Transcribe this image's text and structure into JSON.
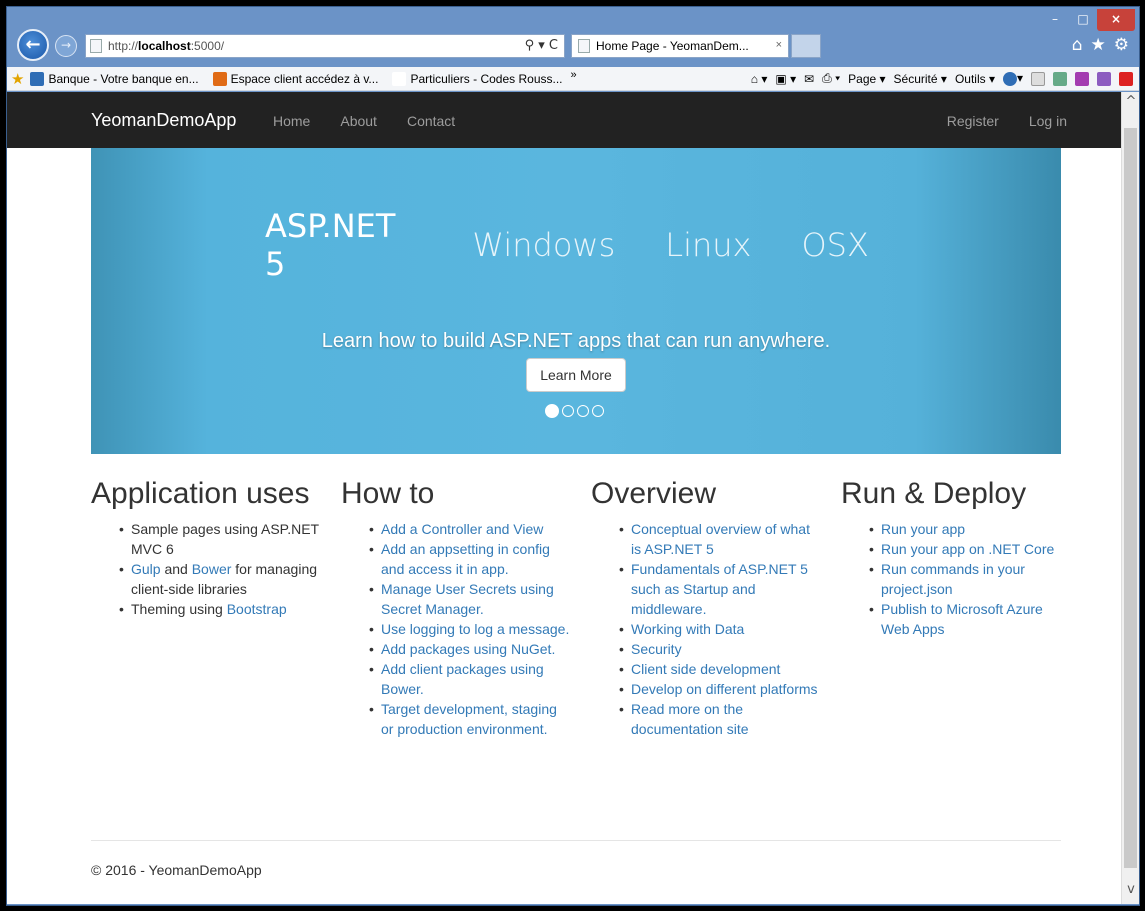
{
  "browser": {
    "window_controls": {
      "minimize": "–",
      "maximize": "□",
      "close": "×"
    },
    "address": {
      "url_prefix": "http://",
      "url_host": "localhost",
      "url_port": ":5000/"
    },
    "address_tools": "⚲ ▾ C",
    "tab": {
      "title": "Home Page - YeomanDem...",
      "close": "×"
    },
    "right_icons": {
      "home": "⌂",
      "favorites": "★",
      "settings": "⚙"
    },
    "favorites": [
      {
        "label": "Banque - Votre banque en...",
        "color": "#2f6db5"
      },
      {
        "label": "Espace client  accédez à v...",
        "color": "#e06b16"
      },
      {
        "label": "Particuliers - Codes Rouss...",
        "color": "#ffffff"
      }
    ],
    "favorites_overflow": "»",
    "commands": {
      "page": "Page ▾",
      "security": "Sécurité ▾",
      "tools": "Outils ▾",
      "help": "▾"
    }
  },
  "site": {
    "brand": "YeomanDemoApp",
    "nav": [
      "Home",
      "About",
      "Contact"
    ],
    "nav_right": [
      "Register",
      "Log in"
    ],
    "hero": {
      "main": "ASP.NET 5",
      "words": [
        "Windows",
        "Linux",
        "OSX"
      ],
      "caption": "Learn how to build ASP.NET apps that can run anywhere.",
      "button": "Learn More"
    },
    "columns": [
      {
        "heading": "Application uses",
        "items": [
          [
            {
              "text": "Sample pages using ASP.NET MVC 6",
              "link": false
            }
          ],
          [
            {
              "text": "Gulp",
              "link": true
            },
            {
              "text": " and ",
              "link": false
            },
            {
              "text": "Bower",
              "link": true
            },
            {
              "text": " for managing client-side libraries",
              "link": false
            }
          ],
          [
            {
              "text": "Theming using ",
              "link": false
            },
            {
              "text": "Bootstrap",
              "link": true
            }
          ]
        ]
      },
      {
        "heading": "How to",
        "items": [
          [
            {
              "text": "Add a Controller and View",
              "link": true
            }
          ],
          [
            {
              "text": "Add an appsetting in config and access it in app.",
              "link": true
            }
          ],
          [
            {
              "text": "Manage User Secrets using Secret Manager.",
              "link": true
            }
          ],
          [
            {
              "text": "Use logging to log a message.",
              "link": true
            }
          ],
          [
            {
              "text": "Add packages using NuGet.",
              "link": true
            }
          ],
          [
            {
              "text": "Add client packages using Bower.",
              "link": true
            }
          ],
          [
            {
              "text": "Target development, staging or production environment.",
              "link": true
            }
          ]
        ]
      },
      {
        "heading": "Overview",
        "items": [
          [
            {
              "text": "Conceptual overview of what is ASP.NET 5",
              "link": true
            }
          ],
          [
            {
              "text": "Fundamentals of ASP.NET 5 such as Startup and middleware.",
              "link": true
            }
          ],
          [
            {
              "text": "Working with Data",
              "link": true
            }
          ],
          [
            {
              "text": "Security",
              "link": true
            }
          ],
          [
            {
              "text": "Client side development",
              "link": true
            }
          ],
          [
            {
              "text": "Develop on different platforms",
              "link": true
            }
          ],
          [
            {
              "text": "Read more on the documentation site",
              "link": true
            }
          ]
        ]
      },
      {
        "heading": "Run & Deploy",
        "items": [
          [
            {
              "text": "Run your app",
              "link": true
            }
          ],
          [
            {
              "text": "Run your app on .NET Core",
              "link": true
            }
          ],
          [
            {
              "text": "Run commands in your project.json",
              "link": true
            }
          ],
          [
            {
              "text": "Publish to Microsoft Azure Web Apps",
              "link": true
            }
          ]
        ]
      }
    ],
    "footer": "© 2016 - YeomanDemoApp"
  },
  "colors": {
    "hero": "#55b3dc",
    "navbar": "#222222",
    "link": "#337ab7"
  }
}
